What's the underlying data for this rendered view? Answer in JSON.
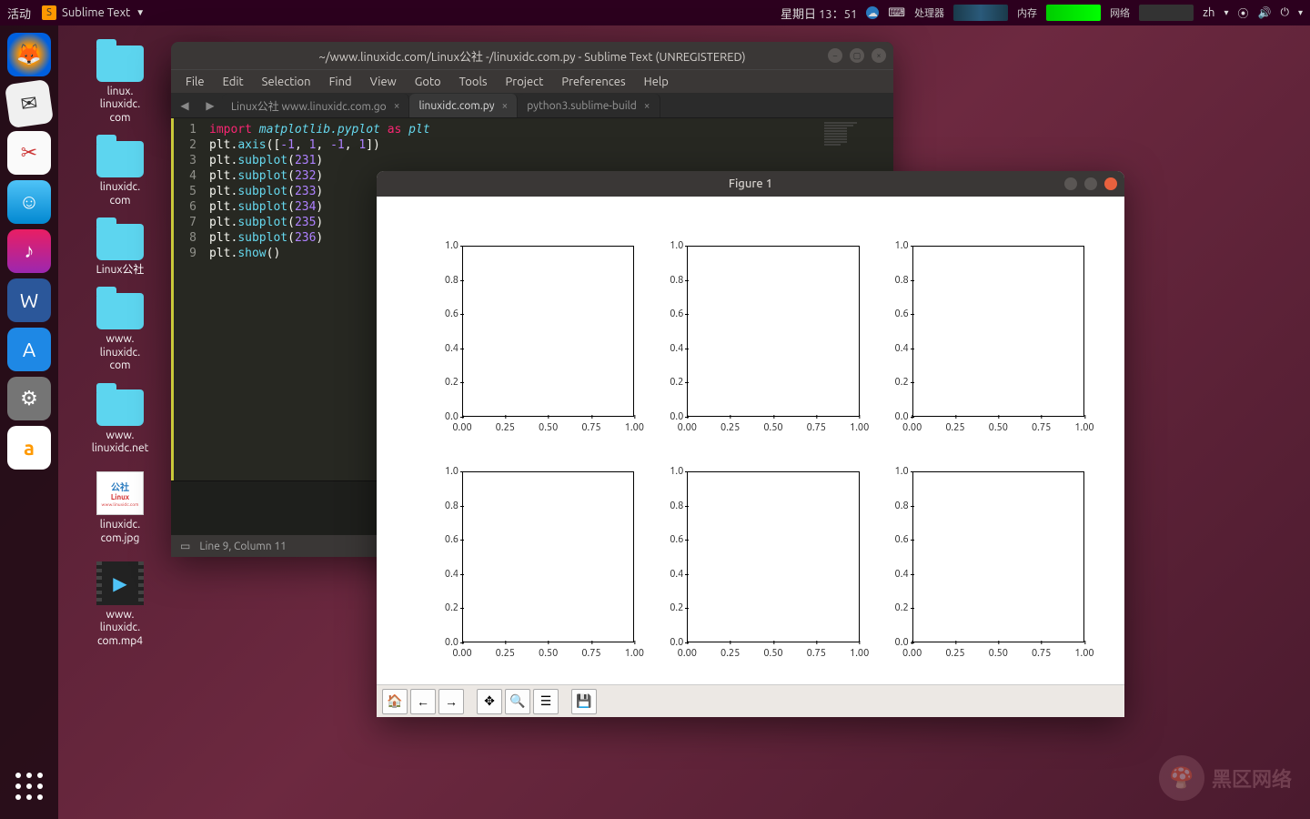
{
  "topbar": {
    "activities": "活动",
    "app_name": "Sublime Text",
    "date": "星期日 13：51",
    "cpu_label": "处理器",
    "mem_label": "内存",
    "net_label": "网络",
    "lang": "zh"
  },
  "desktop": {
    "icons": [
      {
        "label": "linux.\nlinuxidc.\ncom"
      },
      {
        "label": "linuxidc.\ncom"
      },
      {
        "label": "Linux公社"
      },
      {
        "label": "www.\nlinuxidc.\ncom"
      },
      {
        "label": "www.\nlinuxidc.net"
      },
      {
        "label": "linuxidc.\ncom.jpg",
        "type": "img",
        "thumb_text": "公社\nLinux\nwww.linuxidc.com"
      },
      {
        "label": "www.\nlinuxidc.\ncom.mp4",
        "type": "video"
      }
    ]
  },
  "sublime": {
    "title": "~/www.linuxidc.com/Linux公社 -/linuxidc.com.py - Sublime Text (UNREGISTERED)",
    "menu": [
      "File",
      "Edit",
      "Selection",
      "Find",
      "View",
      "Goto",
      "Tools",
      "Project",
      "Preferences",
      "Help"
    ],
    "tabs": [
      {
        "label": "Linux公社 www.linuxidc.com.go",
        "active": false
      },
      {
        "label": "linuxidc.com.py",
        "active": true
      },
      {
        "label": "python3.sublime-build",
        "active": false
      }
    ],
    "code_lines": [
      {
        "n": 1,
        "html": "<span class='kw'>import</span> <span class='lib'>matplotlib.pyplot</span> <span class='kw'>as</span> <span class='lib'>plt</span>"
      },
      {
        "n": 2,
        "html": "plt.<span class='fn'>axis</span>([<span class='num'>-1</span>, <span class='num'>1</span>, <span class='num'>-1</span>, <span class='num'>1</span>])"
      },
      {
        "n": 3,
        "html": "plt.<span class='fn'>subplot</span>(<span class='num'>231</span>)"
      },
      {
        "n": 4,
        "html": "plt.<span class='fn'>subplot</span>(<span class='num'>232</span>)"
      },
      {
        "n": 5,
        "html": "plt.<span class='fn'>subplot</span>(<span class='num'>233</span>)"
      },
      {
        "n": 6,
        "html": "plt.<span class='fn'>subplot</span>(<span class='num'>234</span>)"
      },
      {
        "n": 7,
        "html": "plt.<span class='fn'>subplot</span>(<span class='num'>235</span>)"
      },
      {
        "n": 8,
        "html": "plt.<span class='fn'>subplot</span>(<span class='num'>236</span>)"
      },
      {
        "n": 9,
        "html": "plt.<span class='fn'>show</span>()"
      }
    ],
    "status": "Line 9, Column 11"
  },
  "figure": {
    "title": "Figure 1",
    "toolbar": [
      "home",
      "back",
      "forward",
      "",
      "pan",
      "zoom",
      "configure",
      "",
      "save"
    ]
  },
  "chart_data": [
    {
      "type": "line",
      "series": [],
      "xlim": [
        0.0,
        1.0
      ],
      "ylim": [
        0.0,
        1.0
      ],
      "xticks": [
        0.0,
        0.25,
        0.5,
        0.75,
        1.0
      ],
      "yticks": [
        0.0,
        0.2,
        0.4,
        0.6,
        0.8,
        1.0
      ]
    },
    {
      "type": "line",
      "series": [],
      "xlim": [
        0.0,
        1.0
      ],
      "ylim": [
        0.0,
        1.0
      ],
      "xticks": [
        0.0,
        0.25,
        0.5,
        0.75,
        1.0
      ],
      "yticks": [
        0.0,
        0.2,
        0.4,
        0.6,
        0.8,
        1.0
      ]
    },
    {
      "type": "line",
      "series": [],
      "xlim": [
        0.0,
        1.0
      ],
      "ylim": [
        0.0,
        1.0
      ],
      "xticks": [
        0.0,
        0.25,
        0.5,
        0.75,
        1.0
      ],
      "yticks": [
        0.0,
        0.2,
        0.4,
        0.6,
        0.8,
        1.0
      ]
    },
    {
      "type": "line",
      "series": [],
      "xlim": [
        0.0,
        1.0
      ],
      "ylim": [
        0.0,
        1.0
      ],
      "xticks": [
        0.0,
        0.25,
        0.5,
        0.75,
        1.0
      ],
      "yticks": [
        0.0,
        0.2,
        0.4,
        0.6,
        0.8,
        1.0
      ]
    },
    {
      "type": "line",
      "series": [],
      "xlim": [
        0.0,
        1.0
      ],
      "ylim": [
        0.0,
        1.0
      ],
      "xticks": [
        0.0,
        0.25,
        0.5,
        0.75,
        1.0
      ],
      "yticks": [
        0.0,
        0.2,
        0.4,
        0.6,
        0.8,
        1.0
      ]
    },
    {
      "type": "line",
      "series": [],
      "xlim": [
        0.0,
        1.0
      ],
      "ylim": [
        0.0,
        1.0
      ],
      "xticks": [
        0.0,
        0.25,
        0.5,
        0.75,
        1.0
      ],
      "yticks": [
        0.0,
        0.2,
        0.4,
        0.6,
        0.8,
        1.0
      ]
    }
  ],
  "watermark": "黑区网络"
}
